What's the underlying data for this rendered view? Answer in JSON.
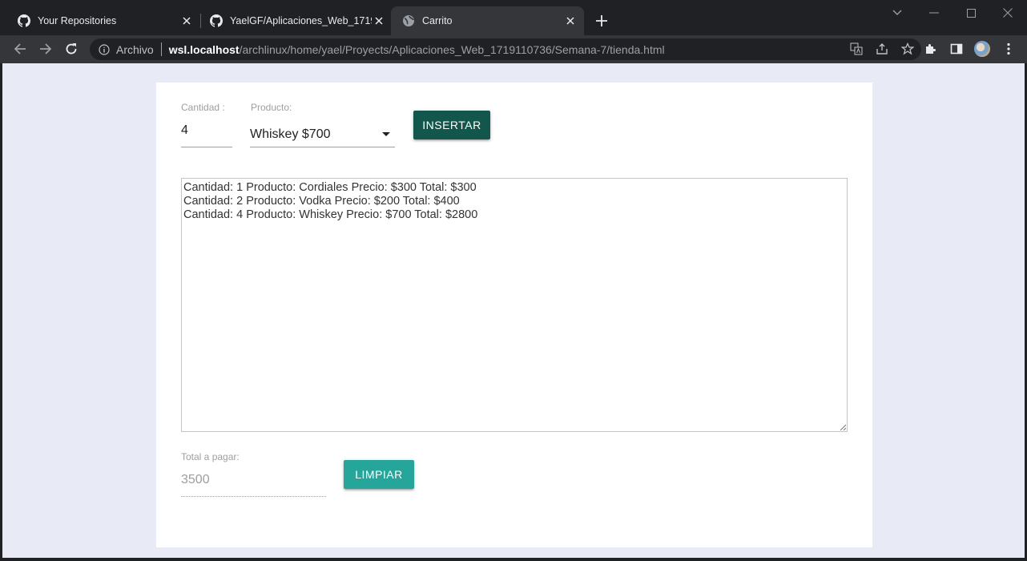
{
  "browser": {
    "tabs": [
      {
        "title": "Your Repositories",
        "icon": "github-icon"
      },
      {
        "title": "YaelGF/Aplicaciones_Web_17191",
        "icon": "github-icon"
      },
      {
        "title": "Carrito",
        "icon": "globe-icon"
      }
    ],
    "active_tab": 2,
    "address": {
      "security_chip": "Archivo",
      "host": "wsl.localhost",
      "path": "/archlinux/home/yael/Proyects/Aplicaciones_Web_1719110736/Semana-7/tienda.html"
    }
  },
  "form": {
    "quantity_label": "Cantidad :",
    "quantity_value": "4",
    "product_label": "Producto:",
    "product_selected": "Whiskey $700",
    "insert_button": "INSERTAR"
  },
  "cart": {
    "lines": [
      "Cantidad: 1 Producto: Cordiales Precio: $300 Total: $300",
      "Cantidad: 2 Producto: Vodka Precio: $200 Total: $400",
      "Cantidad: 4 Producto: Whiskey Precio: $700 Total: $2800"
    ]
  },
  "summary": {
    "total_label": "Total a pagar:",
    "total_value": "3500",
    "clear_button": "LIMPIAR"
  },
  "colors": {
    "insert_button": "#13564b",
    "clear_button": "#26a69a",
    "page_background": "#e8eaf6"
  }
}
